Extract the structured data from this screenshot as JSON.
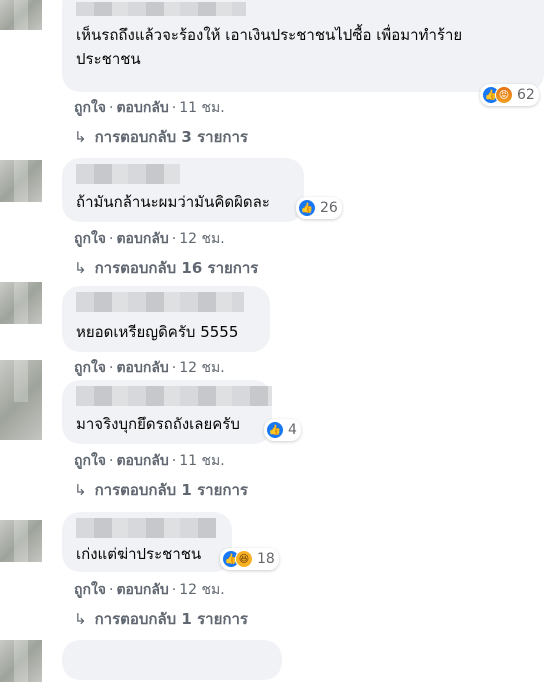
{
  "comments": [
    {
      "text_line1": "เห็นรถถึงแล้วจะร้องให้ เอาเงินประชาชนไปซื้อ เพื่อมาทำร้าย",
      "text_line2": "ประชาชน",
      "like_label": "ถูกใจ",
      "reply_label": "ตอบกลับ",
      "time": "11 ชม.",
      "reaction_count": "62",
      "reactions": [
        "like-icon",
        "angry-icon"
      ],
      "replies": "การตอบกลับ 3 รายการ"
    },
    {
      "text_line1": "ถ้ามันกล้านะผมว่ามันคิดผิดละ",
      "like_label": "ถูกใจ",
      "reply_label": "ตอบกลับ",
      "time": "12 ชม.",
      "reaction_count": "26",
      "reactions": [
        "like-icon"
      ],
      "replies": "การตอบกลับ 16 รายการ"
    },
    {
      "text_line1": "หยอดเหรียญดิครับ 5555",
      "like_label": "ถูกใจ",
      "reply_label": "ตอบกลับ",
      "time": "12 ชม."
    },
    {
      "text_line1": "มาจริงบุกยึดรถถังเลยครับ",
      "like_label": "ถูกใจ",
      "reply_label": "ตอบกลับ",
      "time": "11 ชม.",
      "reaction_count": "4",
      "reactions": [
        "like-icon"
      ],
      "replies": "การตอบกลับ 1 รายการ"
    },
    {
      "text_line1": "เก่งแต่ฆ่าประชาชน",
      "like_label": "ถูกใจ",
      "reply_label": "ตอบกลับ",
      "time": "12 ชม.",
      "reaction_count": "18",
      "reactions": [
        "like-icon",
        "haha-icon"
      ],
      "replies": "การตอบกลับ 1 รายการ"
    }
  ],
  "colors": {
    "bubble": "#f0f2f5",
    "meta_text": "#606770",
    "like_blue": "#1877f2"
  }
}
